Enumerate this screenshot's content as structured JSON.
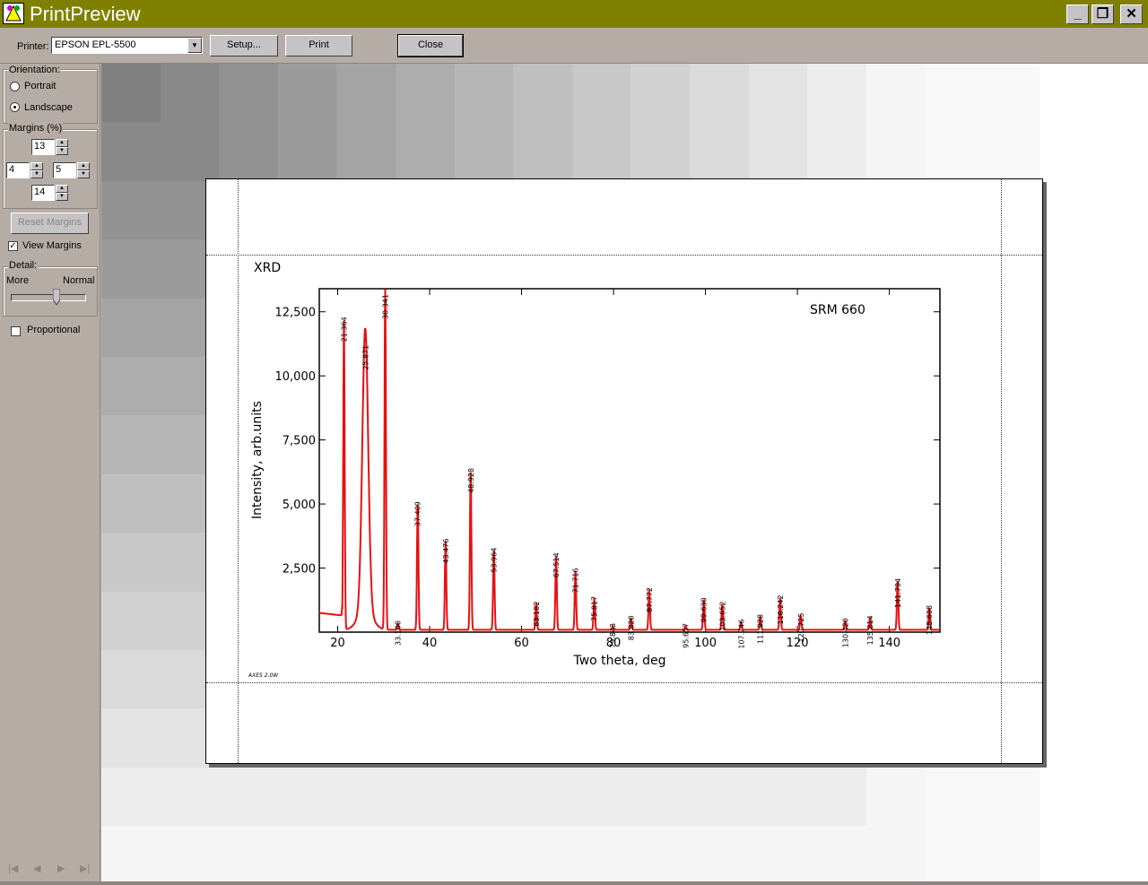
{
  "window": {
    "title": "PrintPreview"
  },
  "toolbar": {
    "printer_label": "Printer:",
    "printer_value": "EPSON EPL-5500",
    "setup_label": "Setup...",
    "print_label": "Print",
    "close_label": "Close"
  },
  "orientation": {
    "label": "Orientation:",
    "portrait": "Portrait",
    "landscape": "Landscape",
    "selected": "Landscape"
  },
  "margins": {
    "label": "Margins (%)",
    "top": "13",
    "left": "4",
    "right": "5",
    "bottom": "14",
    "reset_label": "Reset Margins"
  },
  "view_margins": {
    "label": "View Margins",
    "checked": true
  },
  "detail": {
    "label": "Detail:",
    "more": "More",
    "normal": "Normal",
    "level": 0.6
  },
  "proportional": {
    "label": "Proportional",
    "checked": false
  },
  "chart_data": {
    "type": "line",
    "title": "XRD",
    "annotation": "SRM 660",
    "footer": "AXES 2.0W",
    "xlabel": "Two theta, deg",
    "ylabel": "Intensity, arb.units",
    "xlim": [
      16,
      151
    ],
    "ylim": [
      0,
      13400
    ],
    "xticks": [
      20,
      40,
      60,
      80,
      100,
      120,
      140
    ],
    "yticks": [
      2500,
      5000,
      7500,
      10000,
      12500
    ],
    "ytick_labels": [
      "2,500",
      "5,000",
      "7,500",
      "10,000",
      "12,500"
    ],
    "color": "#e81010",
    "peaks": [
      {
        "x": 21.364,
        "y": 12200,
        "label": "21.364"
      },
      {
        "x": 26.0,
        "y": 11100,
        "label": "25.871"
      },
      {
        "x": 30.341,
        "y": 13400,
        "label": "30.341"
      },
      {
        "x": 33.1,
        "y": 350,
        "label": "33.100"
      },
      {
        "x": 37.409,
        "y": 5000,
        "label": "37.409"
      },
      {
        "x": 43.476,
        "y": 3550,
        "label": "43.476"
      },
      {
        "x": 48.928,
        "y": 6300,
        "label": "48.928"
      },
      {
        "x": 53.964,
        "y": 3200,
        "label": "53.964"
      },
      {
        "x": 63.182,
        "y": 1100,
        "label": "63.182"
      },
      {
        "x": 67.514,
        "y": 3000,
        "label": "67.514"
      },
      {
        "x": 71.716,
        "y": 2400,
        "label": "71.716"
      },
      {
        "x": 75.817,
        "y": 1300,
        "label": "75.817"
      },
      {
        "x": 79.843,
        "y": 250,
        "label": "79.843"
      },
      {
        "x": 83.82,
        "y": 550,
        "label": "83.820"
      },
      {
        "x": 87.772,
        "y": 1650,
        "label": "87.772"
      },
      {
        "x": 95.657,
        "y": 250,
        "label": "95.657"
      },
      {
        "x": 99.63,
        "y": 1250,
        "label": "99.630"
      },
      {
        "x": 103.652,
        "y": 1100,
        "label": "103.652"
      },
      {
        "x": 107.746,
        "y": 400,
        "label": "107.746"
      },
      {
        "x": 111.928,
        "y": 600,
        "label": "111.928"
      },
      {
        "x": 116.242,
        "y": 1350,
        "label": "116.242"
      },
      {
        "x": 120.725,
        "y": 650,
        "label": "120.725"
      },
      {
        "x": 130.42,
        "y": 450,
        "label": "130.420"
      },
      {
        "x": 135.814,
        "y": 550,
        "label": "135.814"
      },
      {
        "x": 141.794,
        "y": 2000,
        "label": "141.794"
      },
      {
        "x": 148.698,
        "y": 950,
        "label": "148.698"
      }
    ]
  }
}
